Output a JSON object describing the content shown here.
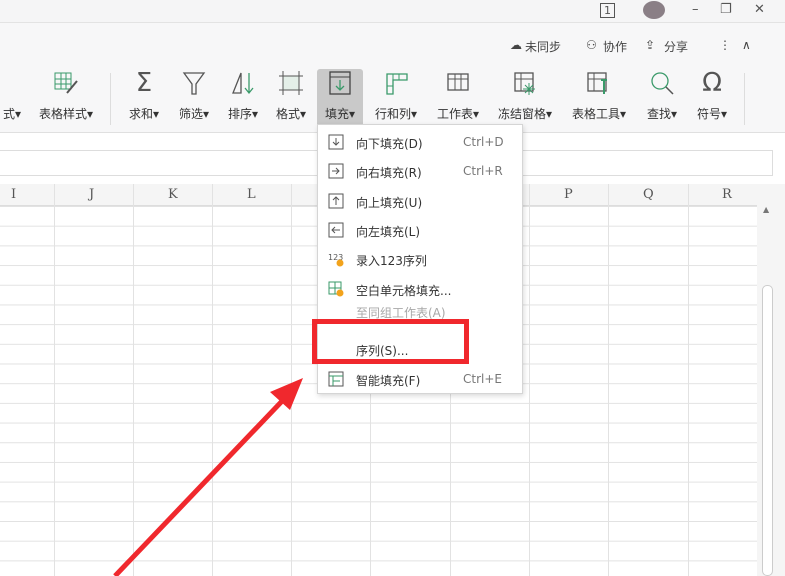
{
  "titlebar": {
    "badge": "1",
    "min": "–",
    "restore": "❐",
    "close": "✕"
  },
  "account_bar": {
    "sync": "未同步",
    "collab": "协作",
    "share": "分享",
    "more": "⋮",
    "collapse": "∧"
  },
  "ribbon": [
    {
      "label": "式",
      "caret": "▾"
    },
    {
      "label": "表格样式",
      "caret": "▾"
    },
    {
      "label": "求和",
      "caret": "▾"
    },
    {
      "label": "筛选",
      "caret": "▾"
    },
    {
      "label": "排序",
      "caret": "▾"
    },
    {
      "label": "格式",
      "caret": "▾"
    },
    {
      "label": "填充",
      "caret": "▾"
    },
    {
      "label": "行和列",
      "caret": "▾"
    },
    {
      "label": "工作表",
      "caret": "▾"
    },
    {
      "label": "冻结窗格",
      "caret": "▾"
    },
    {
      "label": "表格工具",
      "caret": "▾"
    },
    {
      "label": "查找",
      "caret": "▾"
    },
    {
      "label": "符号",
      "caret": "▾"
    }
  ],
  "columns": [
    "I",
    "J",
    "K",
    "L",
    "P",
    "Q",
    "R"
  ],
  "fill_menu": [
    {
      "label": "向下填充(D)",
      "shortcut": "Ctrl+D"
    },
    {
      "label": "向右填充(R)",
      "shortcut": "Ctrl+R"
    },
    {
      "label": "向上填充(U)",
      "shortcut": ""
    },
    {
      "label": "向左填充(L)",
      "shortcut": ""
    },
    {
      "label": "录入123序列",
      "shortcut": ""
    },
    {
      "label": "空白单元格填充...",
      "shortcut": ""
    },
    {
      "label": "至同组工作表(A)",
      "shortcut": ""
    },
    {
      "label": "序列(S)...",
      "shortcut": ""
    },
    {
      "label": "智能填充(F)",
      "shortcut": "Ctrl+E"
    }
  ],
  "colors": {
    "highlight": "#f0282d",
    "arrow": "#f0282d",
    "accent": "#3a9a6a"
  }
}
